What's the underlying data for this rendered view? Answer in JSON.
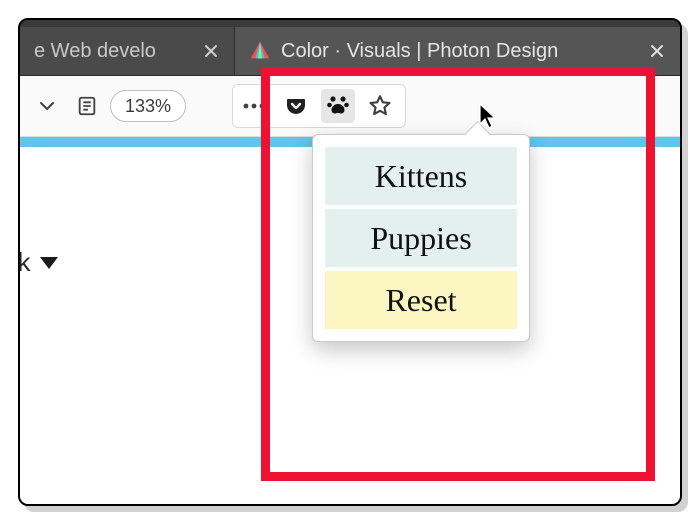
{
  "tabs": [
    {
      "label": "e Web develo",
      "active": false
    },
    {
      "label": "Color · Visuals | Photon Design",
      "active": true
    }
  ],
  "toolbar": {
    "zoom": "133%"
  },
  "page": {
    "fragment": "ack"
  },
  "popup": {
    "items": [
      {
        "label": "Kittens",
        "kind": "opt"
      },
      {
        "label": "Puppies",
        "kind": "opt"
      },
      {
        "label": "Reset",
        "kind": "reset"
      }
    ]
  },
  "colors": {
    "accent": "#5ec6e8",
    "highlight": "#ee1131"
  }
}
